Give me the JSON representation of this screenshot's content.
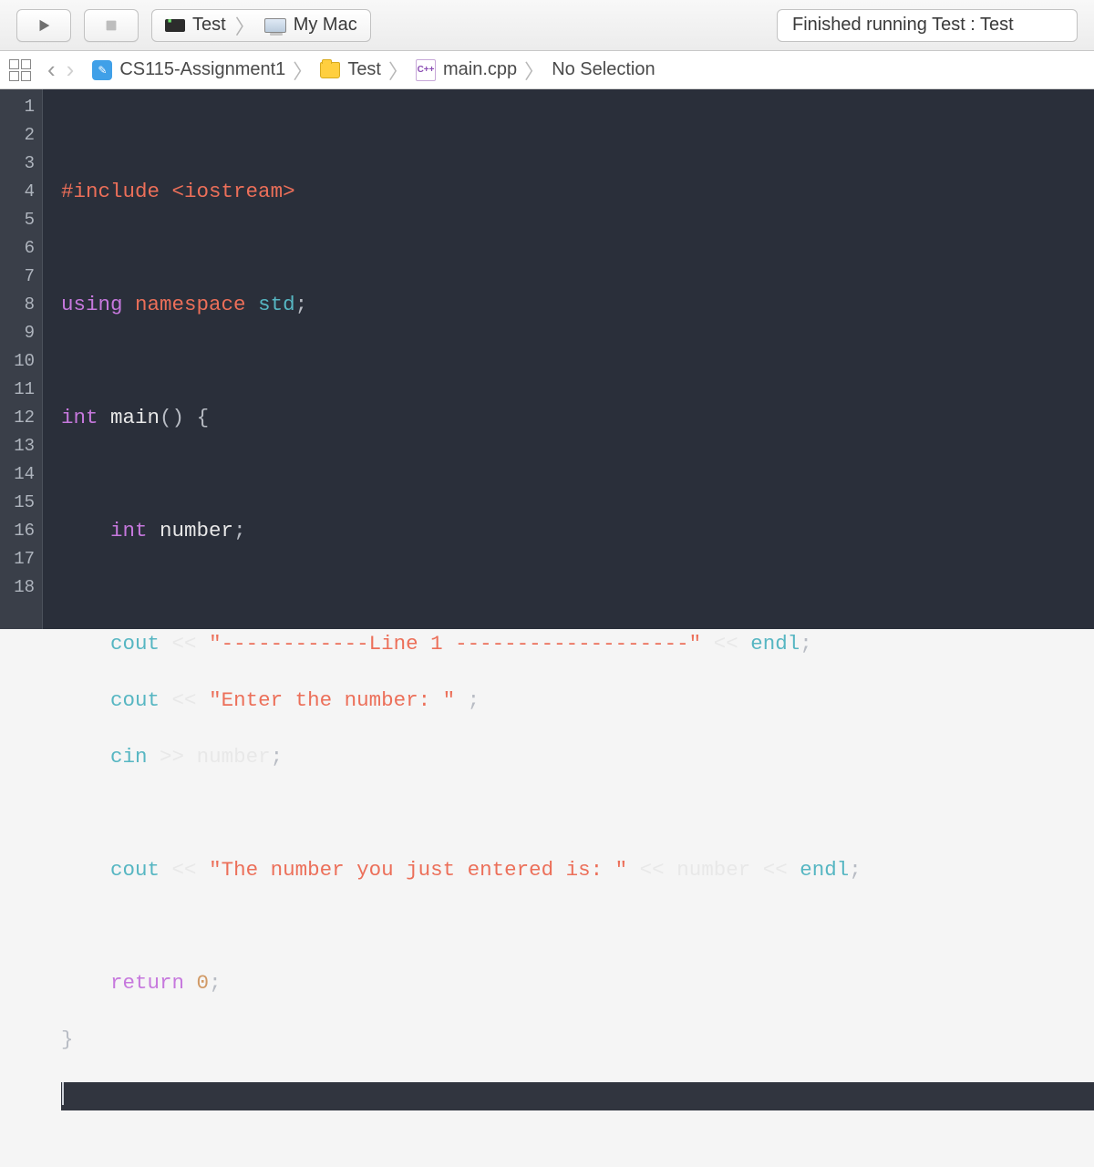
{
  "toolbar": {
    "scheme": "Test",
    "destination": "My Mac",
    "status": "Finished running Test : Test"
  },
  "breadcrumb": {
    "project": "CS115-Assignment1",
    "folder": "Test",
    "file": "main.cpp",
    "selection": "No Selection"
  },
  "code": {
    "line_numbers": [
      "1",
      "2",
      "3",
      "4",
      "5",
      "6",
      "7",
      "8",
      "9",
      "10",
      "11",
      "12",
      "13",
      "14",
      "15",
      "16",
      "17",
      "18"
    ],
    "l2_include": "#include",
    "l2_header": "<iostream>",
    "l4_using": "using",
    "l4_namespace": "namespace",
    "l4_std": "std",
    "l6_int": "int",
    "l6_main": "main",
    "l8_int": "int",
    "l8_number": "number",
    "l10_cout": "cout",
    "l10_str": "\"------------Line 1 -------------------\"",
    "l10_endl": "endl",
    "l11_cout": "cout",
    "l11_str": "\"Enter the number: \"",
    "l12_cin": "cin",
    "l12_number": "number",
    "l14_cout": "cout",
    "l14_str": "\"The number you just entered is: \"",
    "l14_number": "number",
    "l14_endl": "endl",
    "l16_return": "return",
    "l16_zero": "0"
  }
}
